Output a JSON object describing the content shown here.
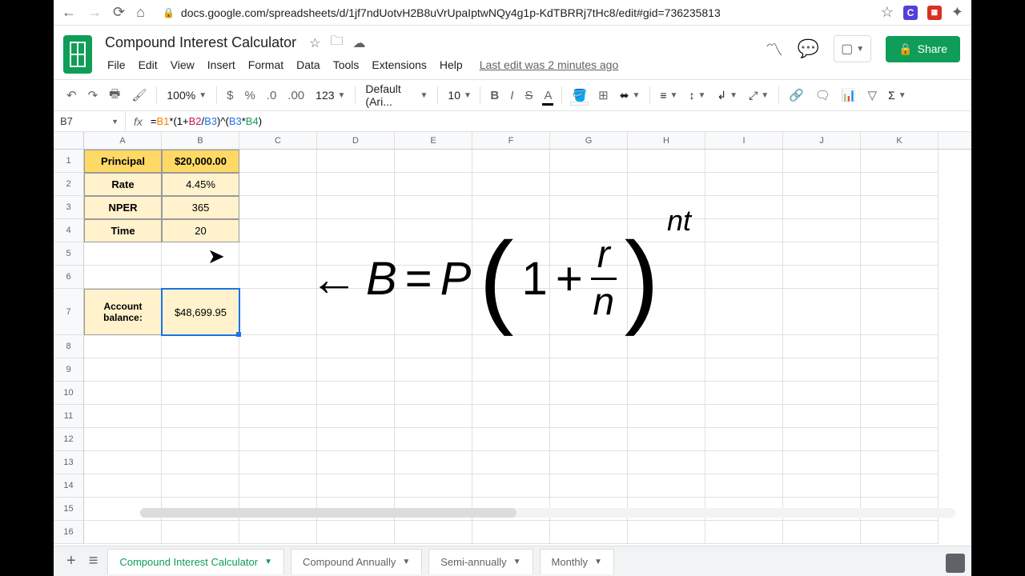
{
  "browser": {
    "url": "docs.google.com/spreadsheets/d/1jf7ndUotvH2B8uVrUpaIptwNQy4g1p-KdTBRRj7tHc8/edit#gid=736235813"
  },
  "doc": {
    "title": "Compound Interest Calculator",
    "last_edit": "Last edit was 2 minutes ago"
  },
  "menu": {
    "file": "File",
    "edit": "Edit",
    "view": "View",
    "insert": "Insert",
    "format": "Format",
    "data": "Data",
    "tools": "Tools",
    "extensions": "Extensions",
    "help": "Help"
  },
  "share": {
    "label": "Share"
  },
  "toolbar": {
    "zoom": "100%",
    "format_num": "123",
    "font": "Default (Ari...",
    "font_size": "10"
  },
  "name_box": "B7",
  "formula": {
    "prefix": "=",
    "r1": "B1",
    "t1": "*(1+",
    "r2": "B2",
    "t2": "/",
    "r3": "B3",
    "t3": ")^(",
    "r3b": "B3",
    "t4": "*",
    "r4": "B4",
    "t5": ")"
  },
  "columns": [
    "A",
    "B",
    "C",
    "D",
    "E",
    "F",
    "G",
    "H",
    "I",
    "J",
    "K"
  ],
  "row_nums": [
    "1",
    "2",
    "3",
    "4",
    "5",
    "6",
    "7",
    "8",
    "9",
    "10",
    "11",
    "12",
    "13",
    "14",
    "15",
    "16"
  ],
  "cells": {
    "A1": "Principal",
    "B1": "$20,000.00",
    "A2": "Rate",
    "B2": "4.45%",
    "A3": "NPER",
    "B3": "365",
    "A4": "Time",
    "B4": "20",
    "A7": "Account balance:",
    "B7": "$48,699.95"
  },
  "tabs": {
    "t1": "Compound Interest Calculator",
    "t2": "Compound Annually",
    "t3": "Semi-annually",
    "t4": "Monthly"
  },
  "overlay": {
    "arrow": "←",
    "B": "B",
    "eq": "=",
    "P": "P",
    "lp": "(",
    "one": "1",
    "plus": "+",
    "r": "r",
    "n": "n",
    "rp": ")",
    "exp": "nt"
  }
}
